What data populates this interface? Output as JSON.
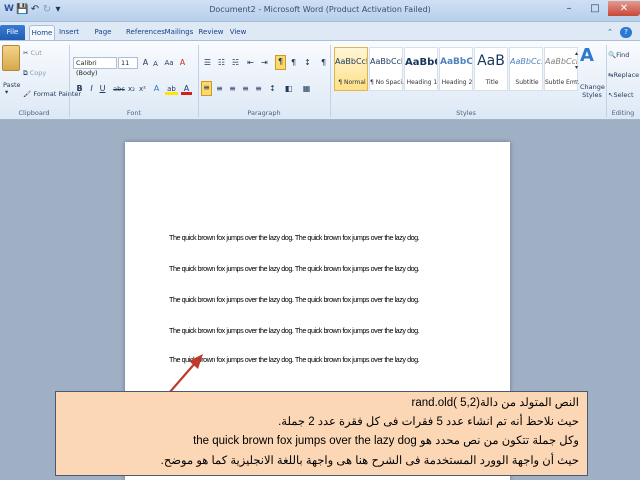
{
  "window": {
    "title": "Document2 - Microsoft Word (Product Activation Failed)",
    "controls": {
      "minimize": "–",
      "maximize": "□",
      "close": "✕"
    }
  },
  "qat": {
    "save_icon": "💾",
    "undo_icon": "↶",
    "redo_icon": "↻",
    "dropdown_icon": "▾"
  },
  "tabs": [
    "File",
    "Home",
    "Insert",
    "Page Layout",
    "References",
    "Mailings",
    "Review",
    "View"
  ],
  "ribbon_right": {
    "help_icon": "?",
    "minimize_icon": "⌃"
  },
  "clipboard": {
    "paste": "Paste",
    "cut": "Cut",
    "copy": "Copy",
    "format_painter": "Format Painter",
    "label": "Clipboard"
  },
  "font": {
    "name": "Calibri (Body)",
    "size": "11",
    "grow": "A",
    "shrink": "A",
    "change_case": "Aa",
    "clear": "A",
    "bold": "B",
    "italic": "I",
    "underline": "U",
    "strike": "abc",
    "subscript": "x₂",
    "superscript": "x²",
    "effects": "A",
    "highlight": "ab",
    "color": "A",
    "label": "Font"
  },
  "paragraph": {
    "bullets": "☰",
    "numbering": "☷",
    "multilevel": "☵",
    "decrease_indent": "⇤",
    "increase_indent": "⇥",
    "ltr": "¶",
    "rtl": "¶",
    "sort": "↕",
    "show_marks": "¶",
    "align_left": "≡",
    "center": "≡",
    "align_right": "≡",
    "justify": "≡",
    "rtl_align": "≡",
    "line_spacing": "↕",
    "shading": "◧",
    "borders": "▦",
    "label": "Paragraph"
  },
  "styles": {
    "items": [
      {
        "preview": "AaBbCcDc",
        "name": "¶ Normal"
      },
      {
        "preview": "AaBbCcDc",
        "name": "¶ No Spaci..."
      },
      {
        "preview": "AaBbCc",
        "name": "Heading 1"
      },
      {
        "preview": "AaBbCc",
        "name": "Heading 2"
      },
      {
        "preview": "AaB",
        "name": "Title"
      },
      {
        "preview": "AaBbCc.",
        "name": "Subtitle"
      },
      {
        "preview": "AaBbCcDc",
        "name": "Subtle Em..."
      }
    ],
    "change_styles": "Change Styles",
    "label": "Styles"
  },
  "editing": {
    "find": "Find",
    "replace": "Replace",
    "select": "Select",
    "label": "Editing"
  },
  "document": {
    "paragraphs": [
      "The quick brown fox jumps over the lazy dog. The quick brown fox jumps over the lazy dog.",
      "The quick brown fox jumps over the lazy dog. The quick brown fox jumps over the lazy dog.",
      "The quick brown fox jumps over the lazy dog. The quick brown fox jumps over the lazy dog.",
      "The quick brown fox jumps over the lazy dog. The quick brown fox jumps over the lazy dog.",
      "The quick brown fox jumps over the lazy dog. The quick brown fox jumps over the lazy dog."
    ]
  },
  "callout": {
    "lines": [
      "النص المتولد من دالة(rand.old( 5,2",
      "حيث نلاحظ أنه تم انشاء عدد 5 فقرات فى كل فقرة عدد 2 جملة.",
      "وكل جملة تتكون من نص محدد هو the quick brown fox jumps over the lazy dog",
      "حيث أن واجهة الوورد المستخدمة فى الشرح هنا هى واجهة باللغة الانجليزية كما هو موضح."
    ]
  },
  "colors": {
    "accent": "#2b579a",
    "callout_bg": "#fbd7b5",
    "arrow": "#c0392b"
  }
}
